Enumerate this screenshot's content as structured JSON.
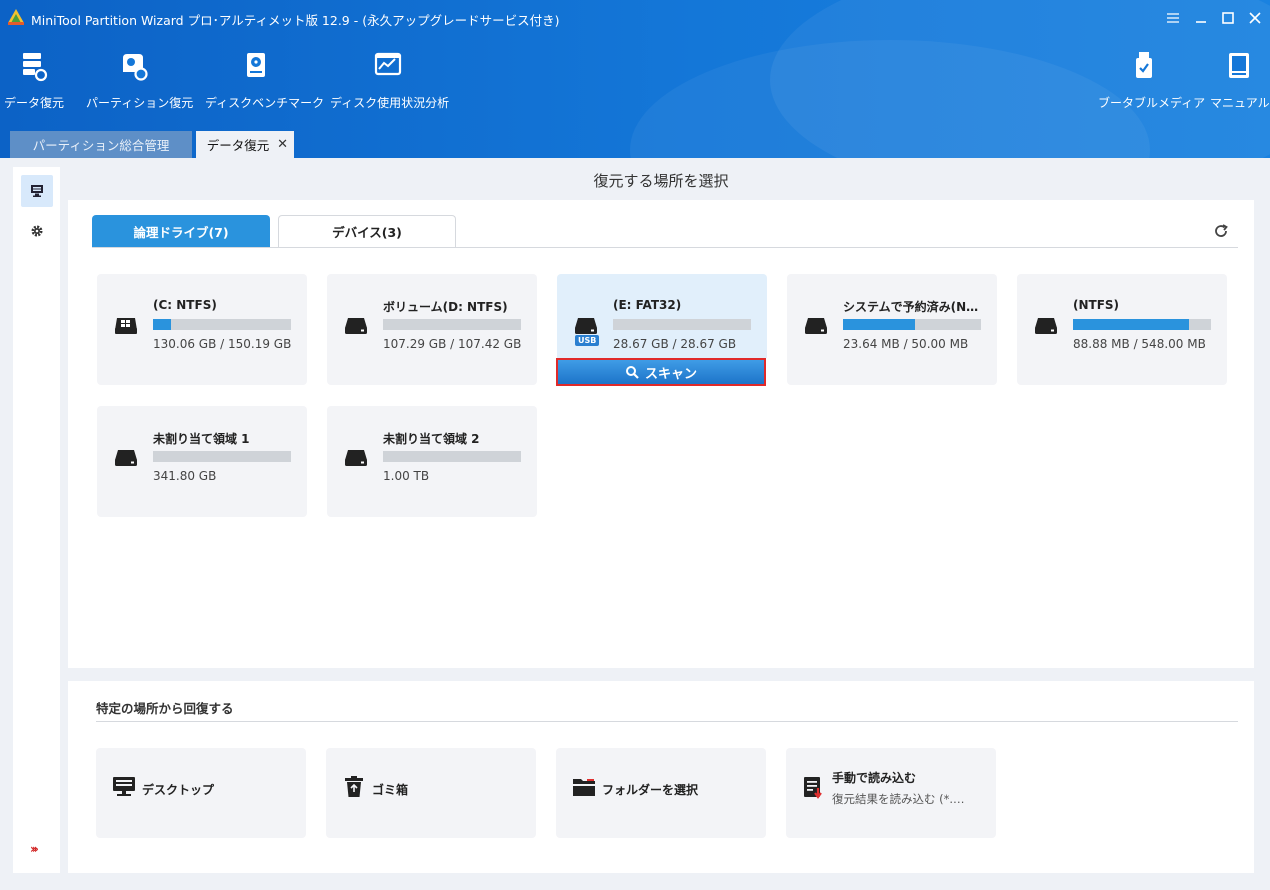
{
  "window": {
    "title": "MiniTool Partition Wizard プロ･アルティメット版 12.9 - (永久アップグレードサービス付き)"
  },
  "toolbar": {
    "items": [
      {
        "label": "データ復元",
        "icon": "data-recovery-icon"
      },
      {
        "label": "パーティション復元",
        "icon": "partition-recovery-icon"
      },
      {
        "label": "ディスクベンチマーク",
        "icon": "disk-benchmark-icon"
      },
      {
        "label": "ディスク使用状況分析",
        "icon": "space-analyzer-icon"
      }
    ],
    "right_items": [
      {
        "label": "ブータブルメディア",
        "icon": "bootable-media-icon"
      },
      {
        "label": "マニュアル",
        "icon": "manual-icon"
      }
    ]
  },
  "tabs": [
    {
      "label": "パーティション総合管理",
      "active": false
    },
    {
      "label": "データ復元",
      "active": true,
      "close": "✕"
    }
  ],
  "main": {
    "title": "復元する場所を選択",
    "drive_tabs": [
      {
        "label": "論理ドライブ(7)",
        "active": true
      },
      {
        "label": "デバイス(3)",
        "active": false
      }
    ],
    "drives": [
      {
        "name": "(C: NTFS)",
        "size": "130.06 GB / 150.19 GB",
        "used_fraction": 0.13,
        "icon": "windows-drive-icon"
      },
      {
        "name": "ボリューム(D: NTFS)",
        "size": "107.29 GB / 107.42 GB",
        "used_fraction": 0.0,
        "icon": "drive-icon"
      },
      {
        "name": "(E: FAT32)",
        "size": "28.67 GB / 28.67 GB",
        "used_fraction": 0.0,
        "icon": "usb-drive-icon",
        "badge": "USB",
        "selected": true
      },
      {
        "name": "システムで予約済み(NT…",
        "size": "23.64 MB / 50.00 MB",
        "used_fraction": 0.52,
        "icon": "drive-icon"
      },
      {
        "name": "(NTFS)",
        "size": "88.88 MB / 548.00 MB",
        "used_fraction": 0.84,
        "icon": "drive-icon"
      },
      {
        "name": "未割り当て領域 1",
        "size": "341.80 GB",
        "used_fraction": 0.0,
        "icon": "drive-icon"
      },
      {
        "name": "未割り当て領域 2",
        "size": "1.00 TB",
        "used_fraction": 0.0,
        "icon": "drive-icon"
      }
    ],
    "scan_button": "スキャン"
  },
  "specific": {
    "title": "特定の場所から回復する",
    "items": [
      {
        "label": "デスクトップ",
        "icon": "desktop-icon"
      },
      {
        "label": "ゴミ箱",
        "icon": "recycle-bin-icon"
      },
      {
        "label": "フォルダーを選択",
        "icon": "folder-icon"
      },
      {
        "label": "手動で読み込む",
        "sub": "復元結果を読み込む (*.…",
        "icon": "load-manually-icon"
      }
    ]
  },
  "colors": {
    "accent": "#2a93dd",
    "header": "#1477d8",
    "highlight_border": "#e02a2a"
  }
}
